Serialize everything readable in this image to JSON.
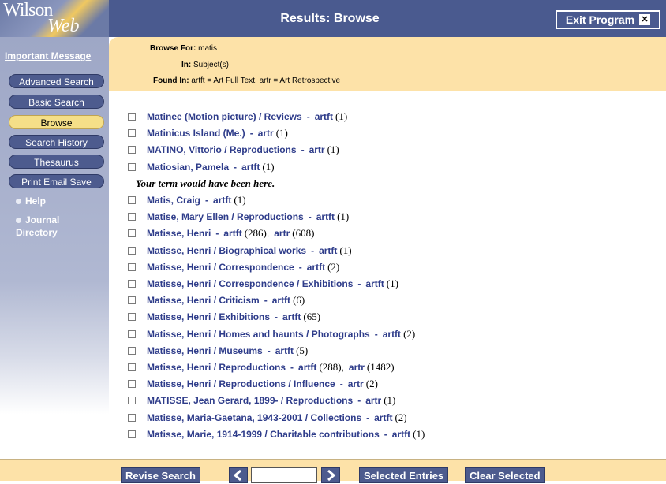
{
  "header": {
    "logo_top": "Wilson",
    "logo_bottom": "Web",
    "title": "Results: Browse",
    "exit_label": "Exit Program",
    "exit_icon": "close-icon"
  },
  "sidebar": {
    "important": "Important Message",
    "buttons": [
      "Advanced Search",
      "Basic Search",
      "Browse",
      "Search History",
      "Thesaurus",
      "Print Email Save"
    ],
    "active": "Browse",
    "links": [
      "Help",
      "Journal Directory"
    ]
  },
  "info": {
    "browse_for_label": "Browse For:",
    "browse_for_value": "matis",
    "in_label": "In:",
    "in_value": "Subject(s)",
    "found_in_label": "Found In:",
    "found_in_value": "artft = Art Full Text, artr = Art Retrospective"
  },
  "results": [
    {
      "term": "Matinee (Motion picture) / Reviews",
      "dbs": [
        {
          "db": "artft",
          "count": "(1)"
        }
      ]
    },
    {
      "term": "Matinicus Island (Me.)",
      "dbs": [
        {
          "db": "artr",
          "count": "(1)"
        }
      ]
    },
    {
      "term": "MATINO, Vittorio / Reproductions",
      "dbs": [
        {
          "db": "artr",
          "count": "(1)"
        }
      ]
    },
    {
      "term": "Matiosian, Pamela",
      "dbs": [
        {
          "db": "artft",
          "count": "(1)"
        }
      ]
    },
    {
      "note": "Your term would have been here."
    },
    {
      "term": "Matis, Craig",
      "dbs": [
        {
          "db": "artft",
          "count": "(1)"
        }
      ]
    },
    {
      "term": "Matise, Mary Ellen / Reproductions",
      "dbs": [
        {
          "db": "artft",
          "count": "(1)"
        }
      ]
    },
    {
      "term": "Matisse, Henri",
      "dbs": [
        {
          "db": "artft",
          "count": "(286)"
        },
        {
          "db": "artr",
          "count": "(608)"
        }
      ]
    },
    {
      "term": "Matisse, Henri / Biographical works",
      "dbs": [
        {
          "db": "artft",
          "count": "(1)"
        }
      ]
    },
    {
      "term": "Matisse, Henri / Correspondence",
      "dbs": [
        {
          "db": "artft",
          "count": "(2)"
        }
      ]
    },
    {
      "term": "Matisse, Henri / Correspondence / Exhibitions",
      "dbs": [
        {
          "db": "artft",
          "count": "(1)"
        }
      ]
    },
    {
      "term": "Matisse, Henri / Criticism",
      "dbs": [
        {
          "db": "artft",
          "count": "(6)"
        }
      ]
    },
    {
      "term": "Matisse, Henri / Exhibitions",
      "dbs": [
        {
          "db": "artft",
          "count": "(65)"
        }
      ]
    },
    {
      "term": "Matisse, Henri / Homes and haunts / Photographs",
      "dbs": [
        {
          "db": "artft",
          "count": "(2)"
        }
      ]
    },
    {
      "term": "Matisse, Henri / Museums",
      "dbs": [
        {
          "db": "artft",
          "count": "(5)"
        }
      ]
    },
    {
      "term": "Matisse, Henri / Reproductions",
      "dbs": [
        {
          "db": "artft",
          "count": "(288)"
        },
        {
          "db": "artr",
          "count": "(1482)"
        }
      ]
    },
    {
      "term": "Matisse, Henri / Reproductions / Influence",
      "dbs": [
        {
          "db": "artr",
          "count": "(2)"
        }
      ]
    },
    {
      "term": "MATISSE, Jean Gerard, 1899- / Reproductions",
      "dbs": [
        {
          "db": "artr",
          "count": "(1)"
        }
      ]
    },
    {
      "term": "Matisse, Maria-Gaetana, 1943-2001 / Collections",
      "dbs": [
        {
          "db": "artft",
          "count": "(2)"
        }
      ]
    },
    {
      "term": "Matisse, Marie, 1914-1999 / Charitable contributions",
      "dbs": [
        {
          "db": "artft",
          "count": "(1)"
        }
      ]
    }
  ],
  "bottom": {
    "revise": "Revise Search",
    "selected": "Selected Entries",
    "clear": "Clear Selected",
    "page_value": ""
  }
}
